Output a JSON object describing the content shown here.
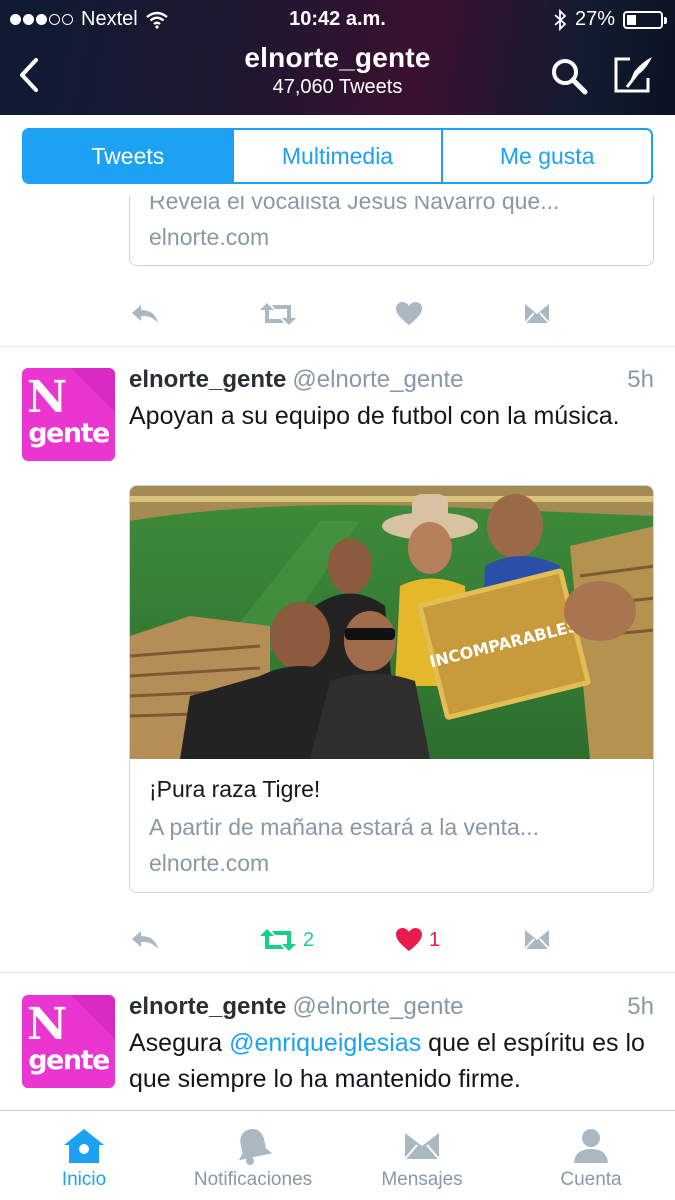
{
  "status_bar": {
    "carrier": "Nextel",
    "time": "10:42 a.m.",
    "battery": "27%",
    "battery_level": 0.27
  },
  "header": {
    "title": "elnorte_gente",
    "subtitle": "47,060 Tweets"
  },
  "tabs": [
    {
      "label": "Tweets",
      "active": true
    },
    {
      "label": "Multimedia",
      "active": false
    },
    {
      "label": "Me gusta",
      "active": false
    }
  ],
  "partial_card": {
    "description": "Revela el vocalista Jesús Navarro que...",
    "domain": "elnorte.com"
  },
  "tweets": [
    {
      "name": "elnorte_gente",
      "handle": "@elnorte_gente",
      "time": "5h",
      "text": "Apoyan a su equipo de futbol con la música.",
      "avatar_letter": "N",
      "avatar_word": "gente",
      "card": {
        "title": "¡Pura raza Tigre!",
        "description": "A partir de mañana estará a la venta...",
        "domain": "elnorte.com",
        "cd_label": "INCOMPARABLES"
      },
      "retweets": "2",
      "likes": "1"
    },
    {
      "name": "elnorte_gente",
      "handle": "@elnorte_gente",
      "time": "5h",
      "text_before": "Asegura ",
      "mention": "@enriqueiglesias",
      "text_after": " que el espíritu es lo que siempre lo ha mantenido firme.",
      "avatar_letter": "N",
      "avatar_word": "gente"
    }
  ],
  "bottom_nav": [
    {
      "label": "Inicio",
      "icon": "home-icon",
      "active": true
    },
    {
      "label": "Notificaciones",
      "icon": "bell-icon",
      "active": false
    },
    {
      "label": "Mensajes",
      "icon": "envelope-icon",
      "active": false
    },
    {
      "label": "Cuenta",
      "icon": "person-icon",
      "active": false
    }
  ],
  "colors": {
    "accent": "#1da1f2",
    "retweet": "#19cf86",
    "like": "#e81c4f",
    "avatar": "#ea35d1",
    "muted": "#8899a6"
  }
}
